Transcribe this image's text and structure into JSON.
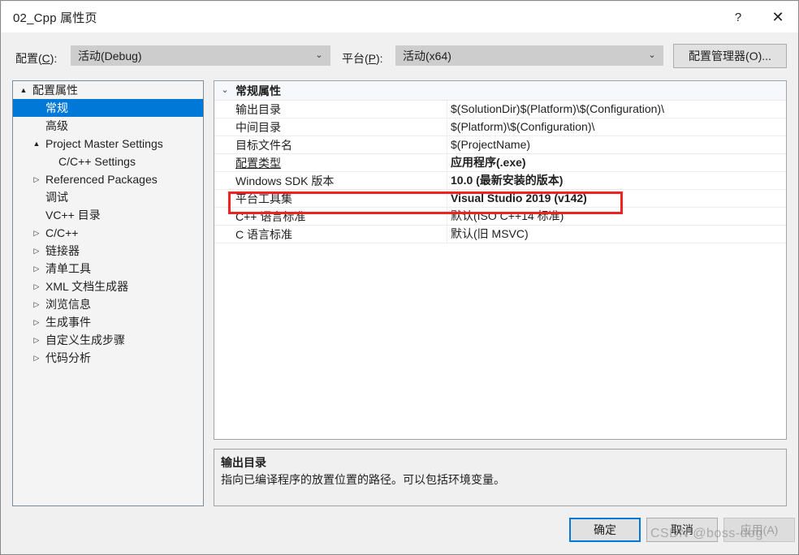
{
  "window": {
    "title": "02_Cpp 属性页",
    "help_label": "?",
    "close_label": "✕"
  },
  "configbar": {
    "config_label_pre": "配置(",
    "config_label_acc": "C",
    "config_label_post": "):",
    "config_value": "活动(Debug)",
    "platform_label_pre": "平台(",
    "platform_label_acc": "P",
    "platform_label_post": "):",
    "platform_value": "活动(x64)",
    "config_manager_label": "配置管理器(O)...",
    "dropdown_arrow": "⌄"
  },
  "tree": {
    "items": [
      {
        "label": "配置属性",
        "indent": 0,
        "expander": "▲",
        "selected": false
      },
      {
        "label": "常规",
        "indent": 1,
        "expander": "",
        "selected": true
      },
      {
        "label": "高级",
        "indent": 1,
        "expander": "",
        "selected": false
      },
      {
        "label": "Project Master Settings",
        "indent": 1,
        "expander": "▲",
        "selected": false
      },
      {
        "label": "C/C++ Settings",
        "indent": 2,
        "expander": "",
        "selected": false
      },
      {
        "label": "Referenced Packages",
        "indent": 1,
        "expander": "▷",
        "selected": false
      },
      {
        "label": "调试",
        "indent": 1,
        "expander": "",
        "selected": false
      },
      {
        "label": "VC++ 目录",
        "indent": 1,
        "expander": "",
        "selected": false
      },
      {
        "label": "C/C++",
        "indent": 1,
        "expander": "▷",
        "selected": false
      },
      {
        "label": "链接器",
        "indent": 1,
        "expander": "▷",
        "selected": false
      },
      {
        "label": "清单工具",
        "indent": 1,
        "expander": "▷",
        "selected": false
      },
      {
        "label": "XML 文档生成器",
        "indent": 1,
        "expander": "▷",
        "selected": false
      },
      {
        "label": "浏览信息",
        "indent": 1,
        "expander": "▷",
        "selected": false
      },
      {
        "label": "生成事件",
        "indent": 1,
        "expander": "▷",
        "selected": false
      },
      {
        "label": "自定义生成步骤",
        "indent": 1,
        "expander": "▷",
        "selected": false
      },
      {
        "label": "代码分析",
        "indent": 1,
        "expander": "▷",
        "selected": false
      }
    ]
  },
  "grid": {
    "group_expander": "⌄",
    "group_label": "常规属性",
    "rows": [
      {
        "name": "输出目录",
        "value": "$(SolutionDir)$(Platform)\\$(Configuration)\\",
        "bold": false,
        "underlined": false,
        "highlighted": false
      },
      {
        "name": "中间目录",
        "value": "$(Platform)\\$(Configuration)\\",
        "bold": false,
        "underlined": false,
        "highlighted": false
      },
      {
        "name": "目标文件名",
        "value": "$(ProjectName)",
        "bold": false,
        "underlined": false,
        "highlighted": false
      },
      {
        "name": "配置类型",
        "value": "应用程序(.exe)",
        "bold": true,
        "underlined": true,
        "highlighted": false
      },
      {
        "name": "Windows SDK 版本",
        "value": "10.0 (最新安装的版本)",
        "bold": true,
        "underlined": false,
        "highlighted": false
      },
      {
        "name": "平台工具集",
        "value": "Visual Studio 2019 (v142)",
        "bold": true,
        "underlined": false,
        "highlighted": true
      },
      {
        "name": "C++ 语言标准",
        "value": "默认(ISO C++14 标准)",
        "bold": false,
        "underlined": false,
        "highlighted": false
      },
      {
        "name": "C 语言标准",
        "value": "默认(旧 MSVC)",
        "bold": false,
        "underlined": false,
        "highlighted": false
      }
    ],
    "annotation_color": "#ee2222"
  },
  "description": {
    "title": "输出目录",
    "body": "指向已编译程序的放置位置的路径。可以包括环境变量。"
  },
  "footer": {
    "ok_label": "确定",
    "cancel_label": "取消",
    "apply_label": "应用(A)"
  },
  "watermark": {
    "text": "CSDN @boss-dog"
  },
  "colors": {
    "accent": "#0078d7",
    "annotation": "#ee2222",
    "dialog_bg": "#f0f0f0"
  }
}
